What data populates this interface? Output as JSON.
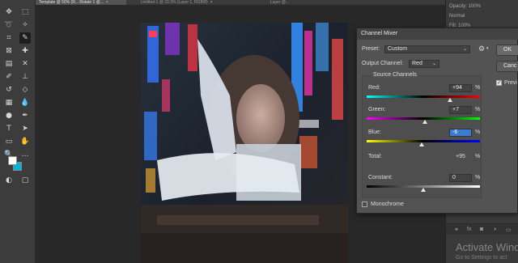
{
  "document_tabs": [
    {
      "label": "Template @ 50% (R... Rotate 1 @...",
      "active": true
    },
    {
      "label": "Untitled-1 @ 33.3% (Layer 1, RGB/8)",
      "active": false
    },
    {
      "label": "Layer @...",
      "active": false
    }
  ],
  "toolbar": {
    "tools": [
      "move-icon",
      "marquee-icon",
      "lasso-icon",
      "magic-wand-icon",
      "crop-icon",
      "eyedropper-icon",
      "frame-icon",
      "brush-icon",
      "healing-icon",
      "stamp-icon",
      "history-brush-icon",
      "eraser-icon",
      "gradient-icon",
      "blur-icon",
      "dodge-icon",
      "pen-icon",
      "type-icon",
      "path-select-icon",
      "shape-icon",
      "hand-icon",
      "zoom-icon",
      "more-icon"
    ],
    "foreground_color": "#ffffff",
    "background_color": "#00b4d8"
  },
  "right_panel": {
    "rows": [
      "Opacity: 100%",
      "Normal",
      "Fill: 100%"
    ]
  },
  "dialog": {
    "title": "Channel Mixer",
    "preset_label": "Preset:",
    "preset_value": "Custom",
    "output_channel_label": "Output Channel:",
    "output_channel_value": "Red",
    "source_channels_label": "Source Channels",
    "red_label": "Red:",
    "red_value": "+94",
    "green_label": "Green:",
    "green_value": "+7",
    "blue_label": "Blue:",
    "blue_value": "-6",
    "total_label": "Total:",
    "total_value": "+95",
    "constant_label": "Constant:",
    "constant_value": "0",
    "pct": "%",
    "monochrome_label": "Monochrome",
    "monochrome_checked": false,
    "preview_label": "Previ",
    "preview_checked": true,
    "ok_label": "OK",
    "cancel_label": "Canc",
    "sliders": {
      "red": 94,
      "green": 7,
      "blue": -6,
      "constant": 0,
      "range": [
        -200,
        200
      ]
    }
  },
  "watermark": {
    "title": "Activate Windo",
    "subtitle": "Go to Settings to act"
  }
}
